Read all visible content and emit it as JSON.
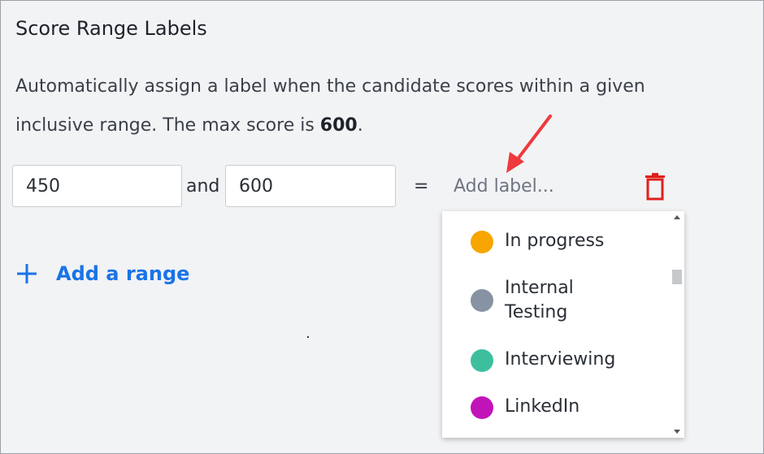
{
  "section": {
    "title": "Score Range Labels",
    "description_prefix": "Automatically assign a label when the candidate scores within a given inclusive range. The max score is ",
    "max_score": "600",
    "description_suffix": "."
  },
  "range": {
    "min_value": "450",
    "and_text": "and",
    "max_value": "600",
    "equals_text": "=",
    "label_placeholder": "Add label..."
  },
  "add_range": {
    "label": "Add a range"
  },
  "dropdown": {
    "options": [
      {
        "label": "In progress",
        "color": "#f7a600"
      },
      {
        "label": "Internal Testing",
        "color": "#8792a2"
      },
      {
        "label": "Interviewing",
        "color": "#3dbf9e"
      },
      {
        "label": "LinkedIn",
        "color": "#c114b8"
      }
    ]
  },
  "colors": {
    "accent": "#1a73e8",
    "delete": "#e0201c",
    "arrow": "#f0393c"
  }
}
